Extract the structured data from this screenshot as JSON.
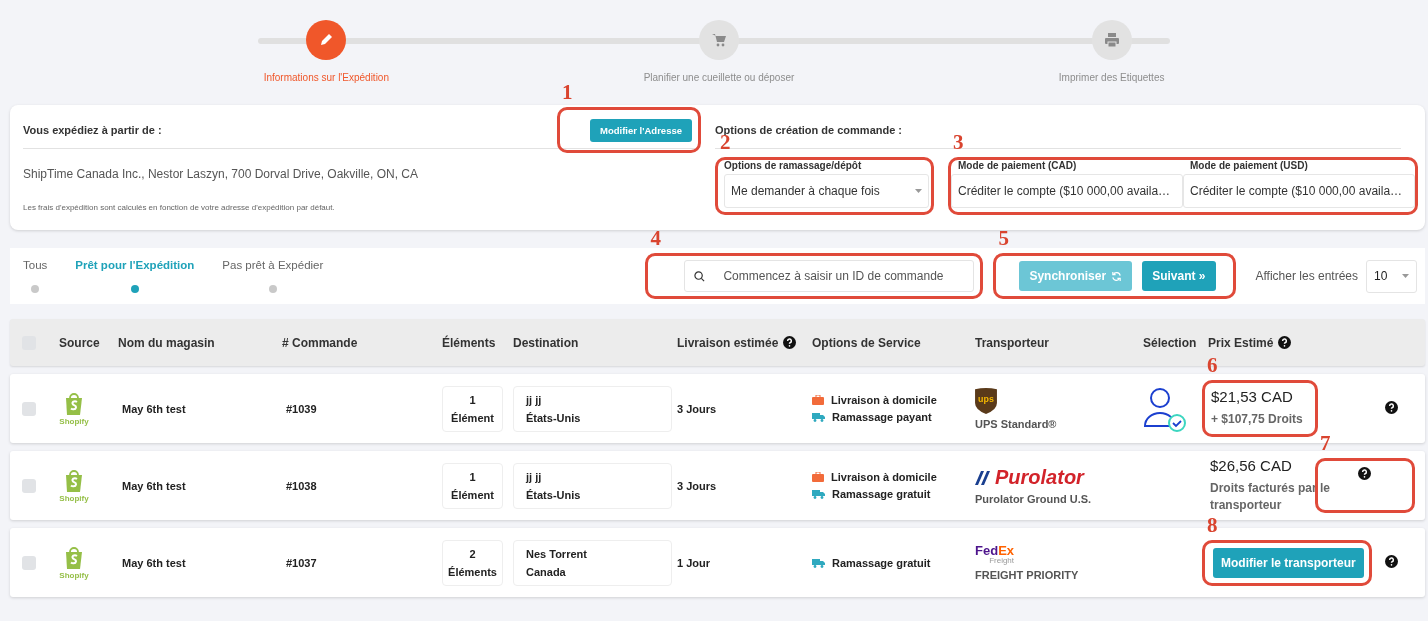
{
  "stepper": [
    {
      "label": "Informations sur l'Expédition",
      "kind": "pencil",
      "selected": true
    },
    {
      "label": "Planifier une cueillette ou déposer",
      "kind": "cart",
      "selected": false
    },
    {
      "label": "Imprimer des Etiquettes",
      "kind": "printer",
      "selected": false
    }
  ],
  "origin": {
    "title": "Vous expédiez à partir de :",
    "button": {
      "label": "Modifier l'Adresse",
      "annotation": "1"
    },
    "address": "ShipTime Canada Inc., Nestor Laszyn, 700 Dorval Drive, Oakville, ON, CA",
    "note": "Les frais d'expédition sont calculés en fonction de votre adresse d'expédition par défaut."
  },
  "order_options": {
    "title": "Options de création de commande :",
    "pickup": {
      "label": "Options de ramassage/dépôt",
      "value": "Me demander à chaque fois",
      "annotation": "2"
    },
    "payment": {
      "annotation": "3",
      "fields": [
        {
          "label": "Mode de paiement (CAD)",
          "value": "Créditer le compte ($10 000,00 availa…"
        },
        {
          "label": "Mode de paiement (USD)",
          "value": "Créditer le compte ($10 000,00 availa…"
        }
      ]
    }
  },
  "tabs": [
    {
      "label": "Tous",
      "selected": false
    },
    {
      "label": "Prêt pour l'Expédition",
      "selected": true
    },
    {
      "label": "Pas prêt à Expédier",
      "selected": false
    }
  ],
  "search": {
    "placeholder": "Commencez à saisir un ID de commande",
    "annotation": "4"
  },
  "actions": {
    "annotation": "5",
    "buttons": [
      {
        "label": "Synchroniser",
        "kind": "sync"
      },
      {
        "label": "Suivant »",
        "kind": "next"
      }
    ]
  },
  "entries": {
    "label": "Afficher les entrées",
    "value": "10"
  },
  "table": {
    "select_all_checked": false,
    "columns": [
      {
        "label": "Source",
        "help": false
      },
      {
        "label": "Nom du magasin",
        "help": false
      },
      {
        "label": "# Commande",
        "help": false
      },
      {
        "label": "Éléments",
        "help": false
      },
      {
        "label": "Destination",
        "help": false
      },
      {
        "label": "Livraison estimée",
        "help": true
      },
      {
        "label": "Options de Service",
        "help": false
      },
      {
        "label": "Transporteur",
        "help": false
      },
      {
        "label": "Sélection",
        "help": false
      },
      {
        "label": "Prix Estimé",
        "help": true
      }
    ],
    "rows": [
      {
        "checked": false,
        "source": "Shopify",
        "store": "May 6th test",
        "order": "#1039",
        "items": [
          "1",
          "Élément"
        ],
        "destination": [
          "jj jj",
          "États-Unis"
        ],
        "delivery": "3 Jours",
        "services": [
          {
            "kind": "home",
            "label": "Livraison à domicile"
          },
          {
            "kind": "pickup",
            "label": "Ramassage payant"
          }
        ],
        "carrier": {
          "kind": "ups",
          "logo": "ups",
          "service": "UPS Standard®"
        },
        "selected": true,
        "price": {
          "kind": "price",
          "amount": "$21,53 CAD",
          "note": "+ $107,75 Droits",
          "annotation": "6"
        },
        "help_annotation": ""
      },
      {
        "checked": false,
        "source": "Shopify",
        "store": "May 6th test",
        "order": "#1038",
        "items": [
          "1",
          "Élément"
        ],
        "destination": [
          "jj jj",
          "États-Unis"
        ],
        "delivery": "3 Jours",
        "services": [
          {
            "kind": "home",
            "label": "Livraison à domicile"
          },
          {
            "kind": "pickup",
            "label": "Ramassage gratuit"
          }
        ],
        "carrier": {
          "kind": "purolator",
          "logo": "Purolator",
          "service": "Purolator Ground U.S."
        },
        "selected": false,
        "price": {
          "kind": "price",
          "amount": "$26,56 CAD",
          "note": "Droits facturés par le transporteur"
        },
        "help_annotation": "7"
      },
      {
        "checked": false,
        "source": "Shopify",
        "store": "May 6th test",
        "order": "#1037",
        "items": [
          "2",
          "Éléments"
        ],
        "destination": [
          "Nes Torrent",
          "Canada"
        ],
        "delivery": "1 Jour",
        "services": [
          {
            "kind": "pickup",
            "label": "Ramassage gratuit"
          }
        ],
        "carrier": {
          "kind": "fedex",
          "logo": "FedEx",
          "logo_sub": "Freight",
          "service": "FREIGHT PRIORITY"
        },
        "selected": false,
        "price": {
          "kind": "button",
          "label": "Modifier le transporteur",
          "annotation": "8"
        },
        "help_annotation": ""
      }
    ]
  }
}
